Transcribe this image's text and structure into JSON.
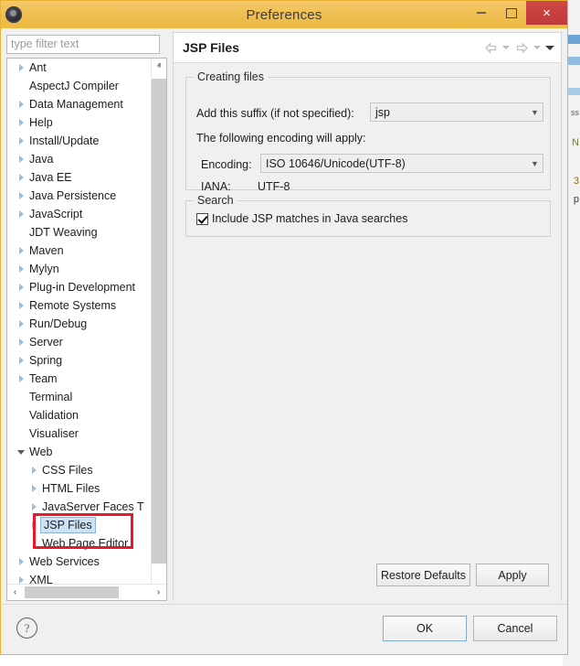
{
  "window": {
    "title": "Preferences",
    "app_icon": "eclipse-icon",
    "controls": {
      "minimize": "minimize-icon",
      "maximize": "maximize-icon",
      "close": "×"
    }
  },
  "sidebar": {
    "filter": {
      "placeholder": "type filter text",
      "value": ""
    },
    "items": [
      {
        "label": "Ant",
        "indent": 0,
        "twisty": "collapsed",
        "selected": false
      },
      {
        "label": "AspectJ Compiler",
        "indent": 0,
        "twisty": "none",
        "selected": false
      },
      {
        "label": "Data Management",
        "indent": 0,
        "twisty": "collapsed",
        "selected": false
      },
      {
        "label": "Help",
        "indent": 0,
        "twisty": "collapsed",
        "selected": false
      },
      {
        "label": "Install/Update",
        "indent": 0,
        "twisty": "collapsed",
        "selected": false
      },
      {
        "label": "Java",
        "indent": 0,
        "twisty": "collapsed",
        "selected": false
      },
      {
        "label": "Java EE",
        "indent": 0,
        "twisty": "collapsed",
        "selected": false
      },
      {
        "label": "Java Persistence",
        "indent": 0,
        "twisty": "collapsed",
        "selected": false
      },
      {
        "label": "JavaScript",
        "indent": 0,
        "twisty": "collapsed",
        "selected": false
      },
      {
        "label": "JDT Weaving",
        "indent": 0,
        "twisty": "none",
        "selected": false
      },
      {
        "label": "Maven",
        "indent": 0,
        "twisty": "collapsed",
        "selected": false
      },
      {
        "label": "Mylyn",
        "indent": 0,
        "twisty": "collapsed",
        "selected": false
      },
      {
        "label": "Plug-in Development",
        "indent": 0,
        "twisty": "collapsed",
        "selected": false
      },
      {
        "label": "Remote Systems",
        "indent": 0,
        "twisty": "collapsed",
        "selected": false
      },
      {
        "label": "Run/Debug",
        "indent": 0,
        "twisty": "collapsed",
        "selected": false
      },
      {
        "label": "Server",
        "indent": 0,
        "twisty": "collapsed",
        "selected": false
      },
      {
        "label": "Spring",
        "indent": 0,
        "twisty": "collapsed",
        "selected": false
      },
      {
        "label": "Team",
        "indent": 0,
        "twisty": "collapsed",
        "selected": false
      },
      {
        "label": "Terminal",
        "indent": 0,
        "twisty": "none",
        "selected": false
      },
      {
        "label": "Validation",
        "indent": 0,
        "twisty": "none",
        "selected": false
      },
      {
        "label": "Visualiser",
        "indent": 0,
        "twisty": "none",
        "selected": false
      },
      {
        "label": "Web",
        "indent": 0,
        "twisty": "expanded",
        "selected": false
      },
      {
        "label": "CSS Files",
        "indent": 1,
        "twisty": "collapsed",
        "selected": false
      },
      {
        "label": "HTML Files",
        "indent": 1,
        "twisty": "collapsed",
        "selected": false
      },
      {
        "label": "JavaServer Faces T",
        "indent": 1,
        "twisty": "collapsed",
        "selected": false
      },
      {
        "label": "JSP Files",
        "indent": 1,
        "twisty": "collapsed",
        "selected": true
      },
      {
        "label": "Web Page Editor",
        "indent": 1,
        "twisty": "none",
        "selected": false
      },
      {
        "label": "Web Services",
        "indent": 0,
        "twisty": "collapsed",
        "selected": false
      },
      {
        "label": "XML",
        "indent": 0,
        "twisty": "collapsed",
        "selected": false
      }
    ],
    "scroll_up_icon": "ⱏ",
    "scroll_down_icon": "ⱟ",
    "scroll_left_icon": "‹",
    "scroll_right_icon": "›"
  },
  "page": {
    "title": "JSP Files",
    "nav": {
      "back_icon": "back-arrow-icon",
      "forward_icon": "forward-arrow-icon",
      "menu_icon": "dropdown-caret-icon"
    },
    "creating_files": {
      "group_title": "Creating files",
      "suffix_label": "Add this suffix (if not specified):",
      "suffix_value": "jsp",
      "encoding_note": "The following encoding will apply:",
      "encoding_label": "Encoding:",
      "encoding_value": "ISO 10646/Unicode(UTF-8)",
      "iana_label": "IANA:",
      "iana_value": "UTF-8"
    },
    "search": {
      "group_title": "Search",
      "checkbox_label": "Include JSP matches in Java searches",
      "checked": true
    },
    "restore_defaults_label": "Restore Defaults",
    "apply_label": "Apply"
  },
  "footer": {
    "help_icon": "?",
    "ok_label": "OK",
    "cancel_label": "Cancel"
  },
  "background": {
    "fragments": [
      "ss",
      "N",
      "3",
      "p"
    ]
  },
  "colors": {
    "title_bar": "#f0bf52",
    "close_button": "#c03b3b",
    "selection": "#cde2f5",
    "annotation": "#e8192c",
    "focus_border": "#7ba9d4"
  }
}
